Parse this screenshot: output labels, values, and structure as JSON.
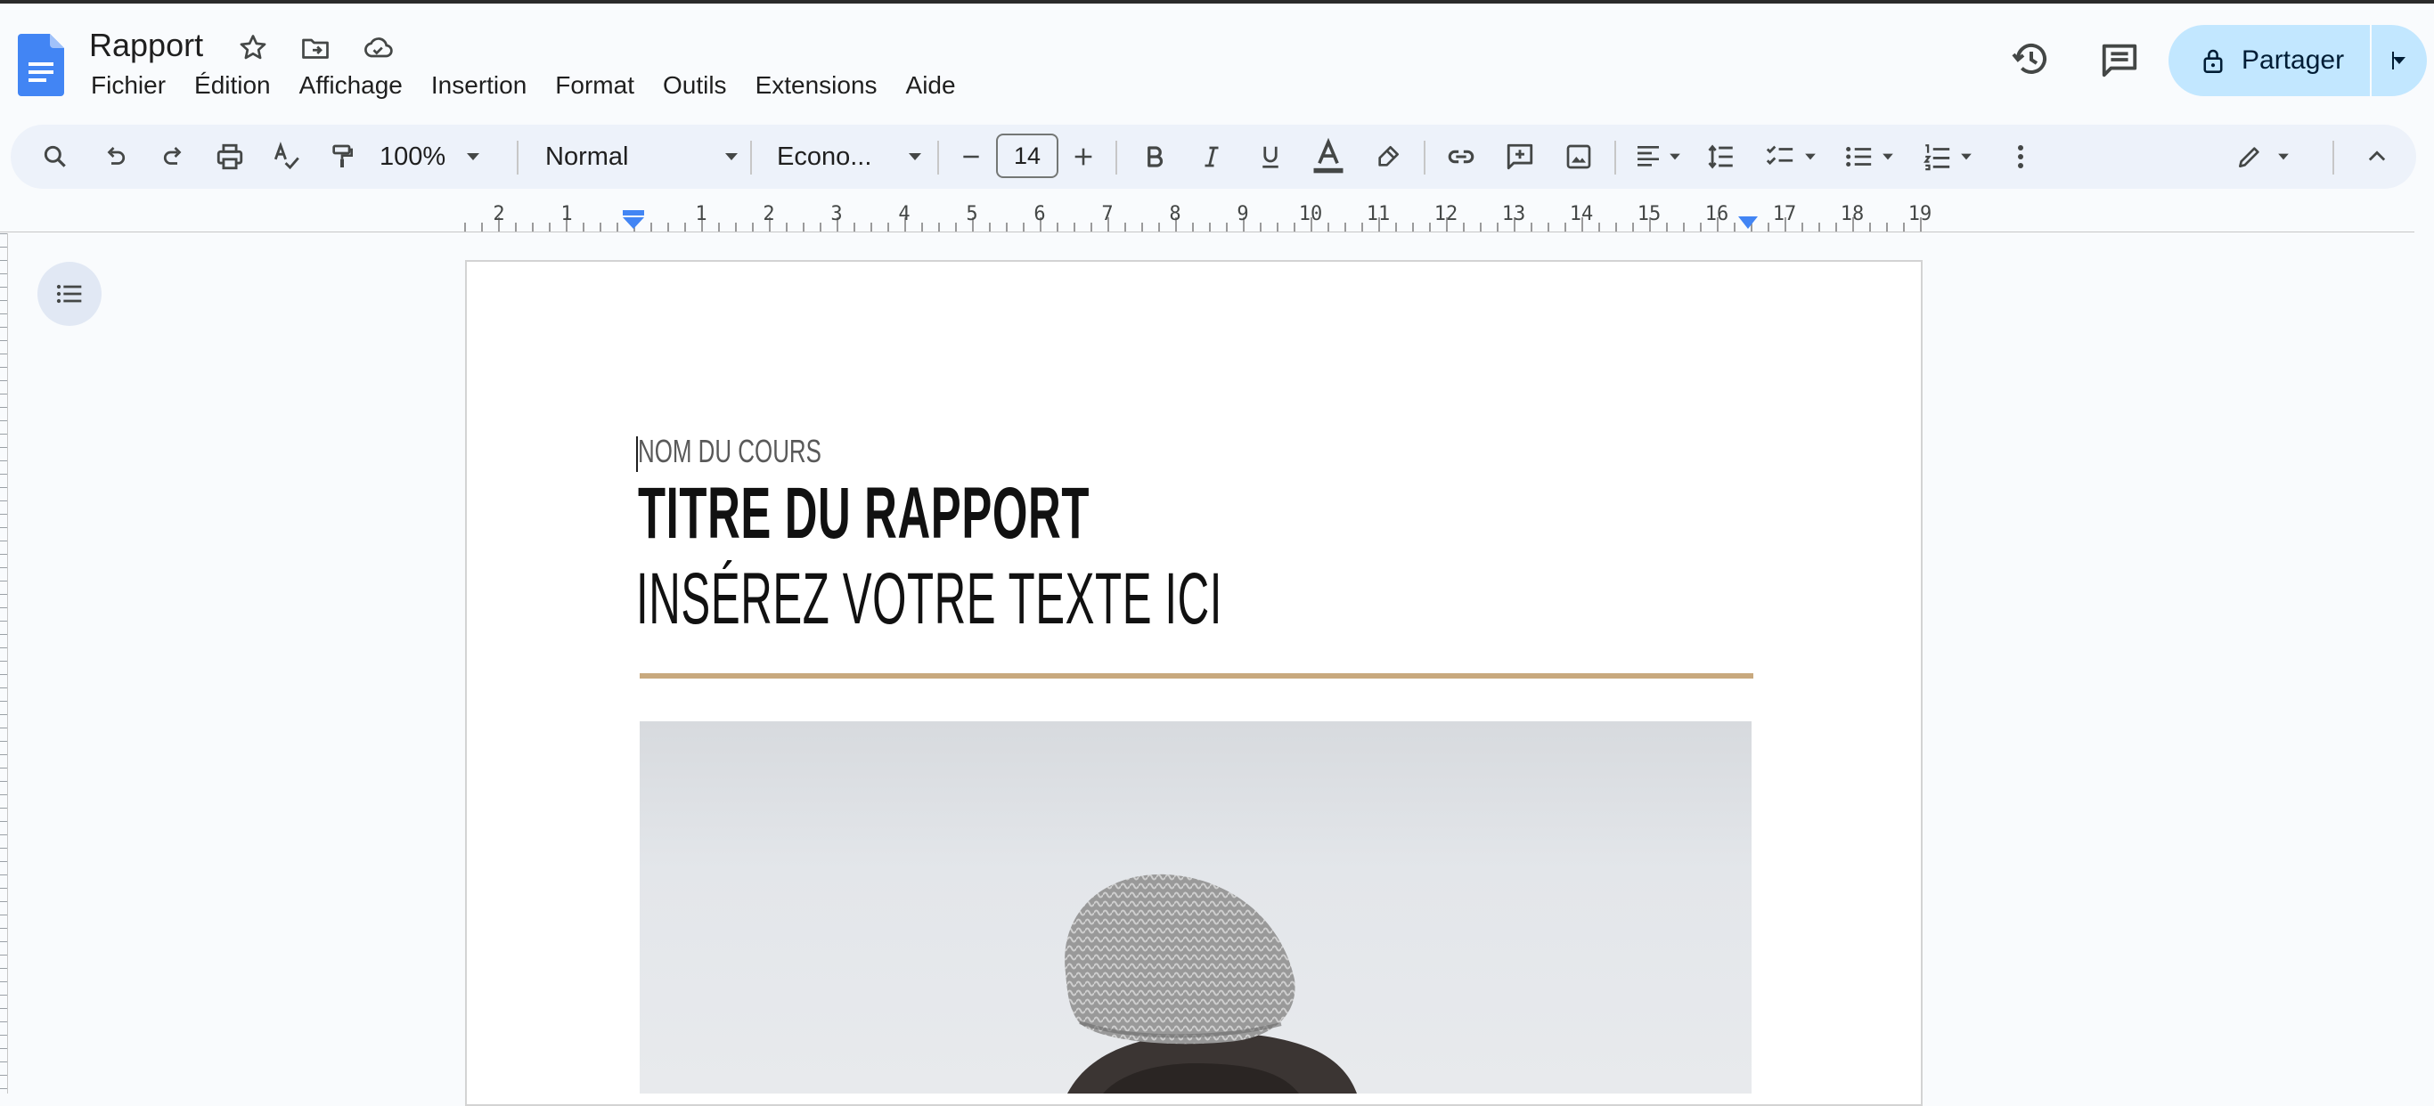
{
  "header": {
    "doc_title": "Rapport",
    "menus": [
      "Fichier",
      "Édition",
      "Affichage",
      "Insertion",
      "Format",
      "Outils",
      "Extensions",
      "Aide"
    ],
    "share_label": "Partager"
  },
  "toolbar": {
    "zoom": "100%",
    "style": "Normal",
    "font": "Econo...",
    "font_size": "14"
  },
  "ruler": {
    "labels": [
      "2",
      "1",
      "1",
      "2",
      "3",
      "4",
      "5",
      "6",
      "7",
      "8",
      "9",
      "10",
      "11",
      "12",
      "13",
      "14",
      "15",
      "16",
      "17",
      "18",
      "19"
    ]
  },
  "document": {
    "course_name": "NOM DU COURS",
    "report_title": "TITRE DU RAPPORT",
    "subtitle": "INSÉREZ VOTRE TEXTE ICI"
  },
  "colors": {
    "accent_rule": "#c8a97e",
    "share_bg": "#c2e7ff",
    "docs_blue": "#4285f4"
  }
}
